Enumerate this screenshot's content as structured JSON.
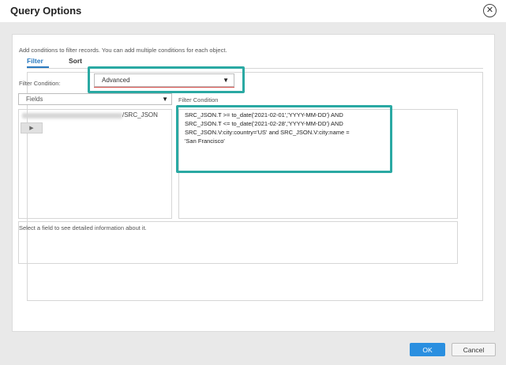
{
  "dialog": {
    "title": "Query Options",
    "close_icon": "close-circle-icon"
  },
  "tabs": [
    {
      "label": "Filter",
      "active": true
    },
    {
      "label": "Sort",
      "active": false
    }
  ],
  "filter": {
    "hint": "Add conditions to filter records. You can add multiple conditions for each object.",
    "condition_label": "Filter Condition:",
    "condition_mode": "Advanced",
    "fields_dropdown": "Fields",
    "object_name": "/SRC_JSON",
    "condition_editor_label": "Filter Condition",
    "condition_text": "SRC_JSON.T >= to_date('2021-02-01','YYYY-MM-DD') AND\nSRC_JSON.T <= to_date('2021-02-28','YYYY-MM-DD') AND\nSRC_JSON.V:city:country='US' and SRC_JSON.V:city:name =\n'San Francisco'",
    "info_text": "Select a field to see detailed information about it."
  },
  "footer": {
    "ok_label": "OK",
    "cancel_label": "Cancel"
  },
  "colors": {
    "accent": "#2a8fe0",
    "highlight": "#2aa9a3",
    "active_tab": "#2a7ac0"
  }
}
